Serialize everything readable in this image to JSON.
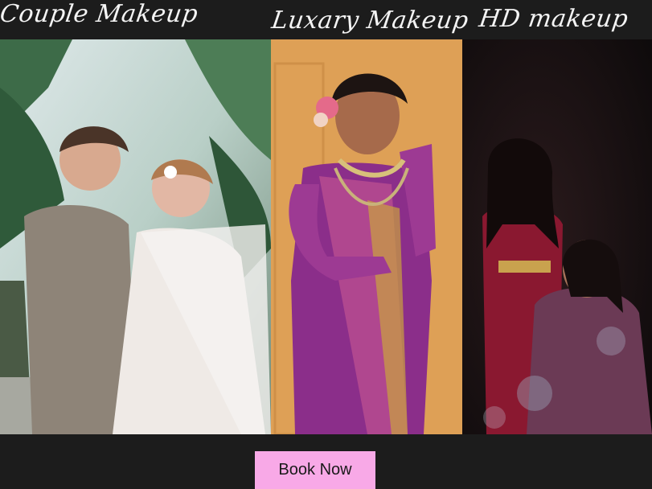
{
  "titles": {
    "couple": "Couple Makeup",
    "luxury": "Luxary Makeup",
    "hd": "HD makeup"
  },
  "cta": {
    "label": "Book Now",
    "color": "#f8a9e7"
  },
  "colors": {
    "background": "#1c1c1c",
    "heading_text": "#f4f4f4"
  }
}
